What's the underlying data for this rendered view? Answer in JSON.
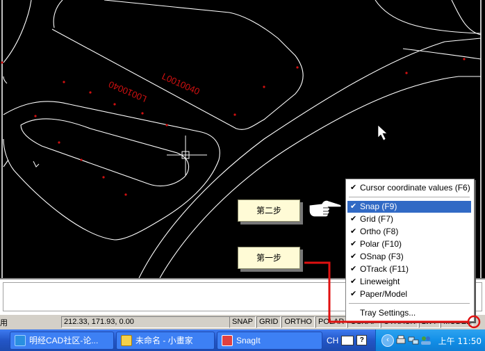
{
  "drawing": {
    "labels": [
      "L0010040",
      "L0010040"
    ],
    "label_color": "#d01010"
  },
  "steps": {
    "step1": "第一步",
    "step2": "第二步"
  },
  "statusbar": {
    "prefix": "用",
    "coords": "212.33, 171.93, 0.00",
    "toggles": [
      "SNAP",
      "GRID",
      "ORTHO",
      "POLAR",
      "OSNAP",
      "OTRACK",
      "LWT",
      "MODEL"
    ]
  },
  "context_menu": {
    "items": [
      {
        "label": "Cursor coordinate values (F6)",
        "checked": true,
        "selected": false
      },
      {
        "label": "Snap (F9)",
        "checked": true,
        "selected": true
      },
      {
        "label": "Grid (F7)",
        "checked": true,
        "selected": false
      },
      {
        "label": "Ortho (F8)",
        "checked": true,
        "selected": false
      },
      {
        "label": "Polar (F10)",
        "checked": true,
        "selected": false
      },
      {
        "label": "OSnap (F3)",
        "checked": true,
        "selected": false
      },
      {
        "label": "OTrack (F11)",
        "checked": true,
        "selected": false
      },
      {
        "label": "Lineweight",
        "checked": true,
        "selected": false
      },
      {
        "label": "Paper/Model",
        "checked": true,
        "selected": false
      },
      {
        "label": "Tray Settings...",
        "checked": false,
        "selected": false
      }
    ],
    "accent_color": "#316ac5"
  },
  "taskbar": {
    "tasks": [
      {
        "label": "明经CAD社区-论...",
        "icon": "ie-icon"
      },
      {
        "label": "未命名 - 小畫家",
        "icon": "paint-icon"
      },
      {
        "label": "SnagIt",
        "icon": "snagit-icon"
      }
    ],
    "language": "CH",
    "clock": "上午 11:50"
  },
  "annotation_color": "#e01010"
}
